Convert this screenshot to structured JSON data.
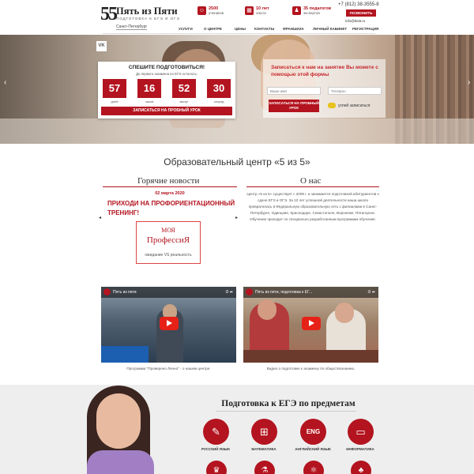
{
  "header": {
    "logo_number": "55",
    "logo_title": "Пять из Пяти",
    "logo_subtitle": "ПОДГОТОВКА К ЕГЭ И ОГЭ",
    "city": "Санкт-Петербург",
    "stats": [
      {
        "value": "2500",
        "label": "учеников"
      },
      {
        "value": "10 лет",
        "label": "опыта"
      },
      {
        "value": "35 педагогов",
        "label": "экспертов"
      }
    ],
    "phone": "+7 (812) 38-3555-8",
    "call_button": "ПОЗВОНИТЬ",
    "email": "info@5is5.ru",
    "nav": [
      "УСЛУГИ",
      "О ЦЕНТРЕ",
      "ЦЕНЫ",
      "КОНТАКТЫ",
      "ФРАНШИЗА",
      "ЛИЧНЫЙ КАБИНЕТ",
      "РЕГИСТРАЦИЯ"
    ]
  },
  "hero": {
    "vk": "VK",
    "countdown": {
      "title": "СПЕШИТЕ ПОДГОТОВИТЬСЯ!",
      "subtitle": "До первого экзамена по ЕГЭ осталось:",
      "items": [
        {
          "value": "57",
          "label": "дней"
        },
        {
          "value": "16",
          "label": "часов"
        },
        {
          "value": "52",
          "label": "минут"
        },
        {
          "value": "30",
          "label": "секунд"
        }
      ],
      "button": "ЗАПИСАТЬСЯ НА ПРОБНЫЙ УРОК"
    },
    "form": {
      "title": "Записаться к нам на занятие Вы можете с помощью этой формы",
      "name_placeholder": "Ваше имя",
      "phone_placeholder": "Телефон",
      "button": "ЗАПИСАТЬСЯ НА ПРОБНЫЙ УРОК",
      "quick": "успей записаться"
    }
  },
  "section": {
    "title": "Образовательный центр «5 из 5»",
    "news_title": "Горячие новости",
    "news_date": "02 марта 2020",
    "news_headline": "ПРИХОДИ НА ПРОФОРИЕНТАЦИОННЫЙ ТРЕНИНГ!",
    "news_card": {
      "line1": "МОЯ",
      "line2": "ПрофессиЯ",
      "line3": "ожидание VS реальность"
    },
    "about_title": "О нас",
    "about_text": "Центр «5 из 5» существует с 2009 г. и занимается подготовкой абитуриентов к сдаче ЕГЭ и ОГЭ. За 10 лет успешной деятельности наша школа превратилась в Федеральную образовательную сеть с филиалами в Санкт-Петербурге, Одинцове, Краснодаре, Севастополе, Воронеже, Пятигорске. Обучение проходит по специально разработанным программам обучения."
  },
  "videos": [
    {
      "title": "Пять из пяти",
      "caption": "Программа \"Проверено Лично\" - о нашем центре."
    },
    {
      "title": "Пять из пяти, подготовка к ЕГ...",
      "caption": "Видео о подготовке к экзамену по обществознанию."
    }
  ],
  "subjects": {
    "title": "Подготовка к ЕГЭ по предметам",
    "items": [
      {
        "label": "РУССКИЙ ЯЗЫК",
        "icon": "book-icon"
      },
      {
        "label": "МАТЕМАТИКА",
        "icon": "abacus-icon"
      },
      {
        "label": "АНГЛИЙСКИЙ ЯЗЫК",
        "icon": "eng-icon"
      },
      {
        "label": "ИНФОРМАТИКА",
        "icon": "monitor-icon"
      }
    ]
  },
  "colors": {
    "accent": "#b3141f"
  }
}
